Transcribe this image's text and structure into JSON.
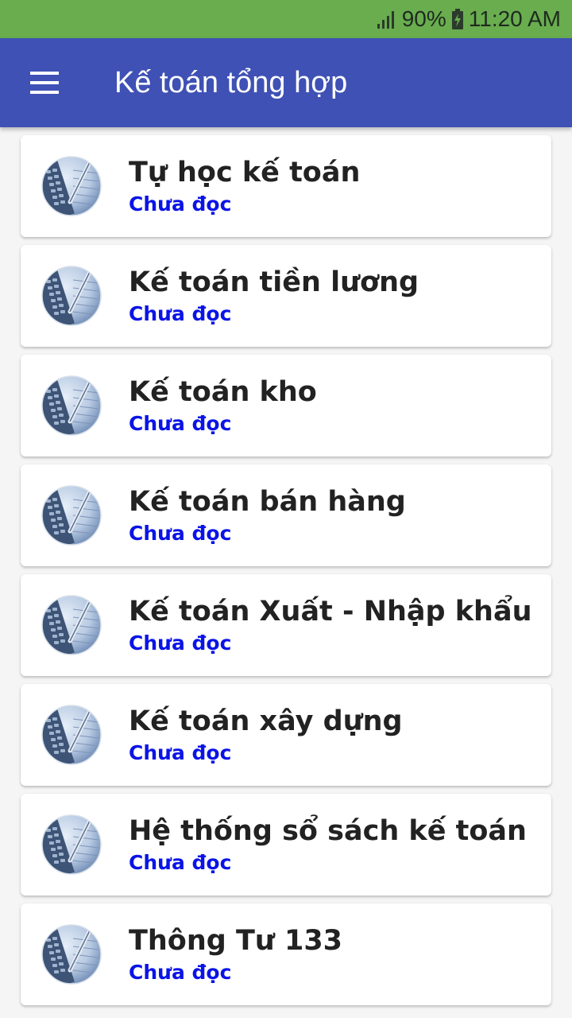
{
  "status_bar": {
    "battery": "90%",
    "time": "11:20 AM",
    "signal_icon": "signal-icon",
    "battery_icon": "battery-charging-icon",
    "background": "#69ad4f"
  },
  "app_bar": {
    "title": "Kế toán tổng hợp",
    "menu_icon": "hamburger-menu-icon",
    "background": "#3f51b5"
  },
  "items": [
    {
      "title": "Tự học kế toán",
      "status": "Chưa đọc"
    },
    {
      "title": "Kế toán tiền lương",
      "status": "Chưa đọc"
    },
    {
      "title": "Kế toán kho",
      "status": "Chưa đọc"
    },
    {
      "title": "Kế toán bán hàng",
      "status": "Chưa đọc"
    },
    {
      "title": "Kế toán Xuất - Nhập khẩu",
      "status": "Chưa đọc"
    },
    {
      "title": "Kế toán xây dựng",
      "status": "Chưa đọc"
    },
    {
      "title": "Hệ thống sổ sách kế toán",
      "status": "Chưa đọc"
    },
    {
      "title": "Thông Tư 133",
      "status": "Chưa đọc"
    }
  ],
  "colors": {
    "status_text": "#0a14e6",
    "title_text": "#222222"
  }
}
